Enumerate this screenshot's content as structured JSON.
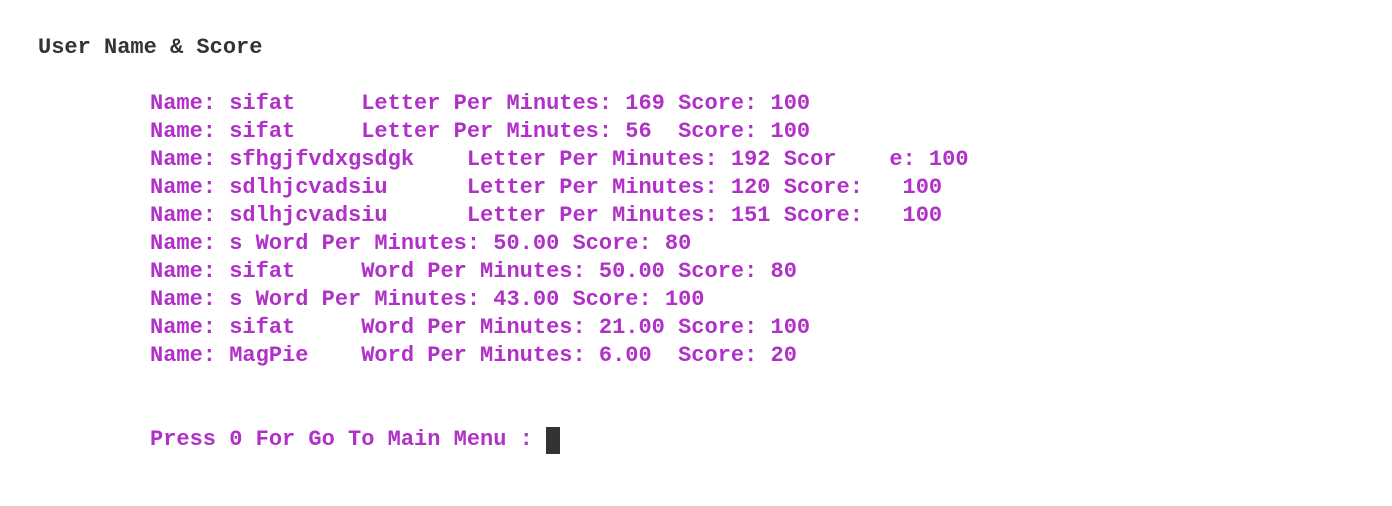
{
  "colors": {
    "heading": "#333333",
    "text": "#b030c8",
    "cursor": "#333333",
    "background": "#ffffff"
  },
  "heading": "User Name & Score",
  "records": [
    "Name: sifat     Letter Per Minutes: 169 Score: 100",
    "Name: sifat     Letter Per Minutes: 56  Score: 100",
    "Name: sfhgjfvdxgsdgk    Letter Per Minutes: 192 Scor    e: 100",
    "Name: sdlhjcvadsiu      Letter Per Minutes: 120 Score:   100",
    "Name: sdlhjcvadsiu      Letter Per Minutes: 151 Score:   100",
    "Name: s Word Per Minutes: 50.00 Score: 80",
    "Name: sifat     Word Per Minutes: 50.00 Score: 80",
    "Name: s Word Per Minutes: 43.00 Score: 100",
    "Name: sifat     Word Per Minutes: 21.00 Score: 100",
    "Name: MagPie    Word Per Minutes: 6.00  Score: 20"
  ],
  "prompt": "Press 0 For Go To Main Menu : "
}
